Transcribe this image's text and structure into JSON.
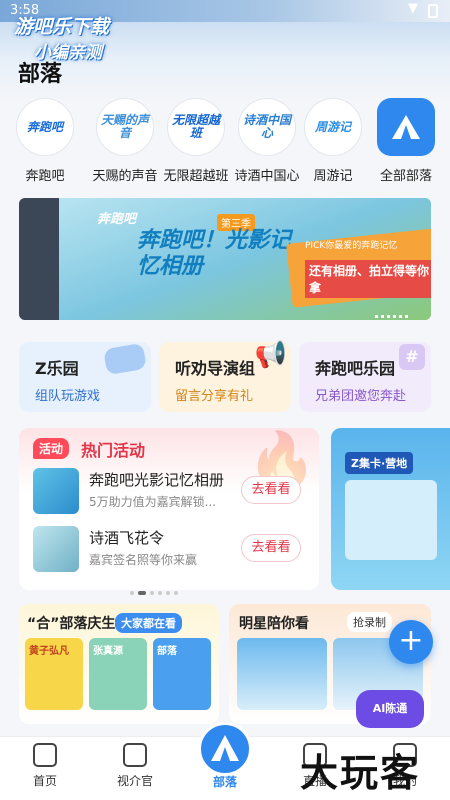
{
  "status": {
    "time": "3:58"
  },
  "watermark": {
    "line1": "游吧乐下载",
    "line2": "小编亲测"
  },
  "page": {
    "title": "部落"
  },
  "tribes": [
    {
      "label": "奔跑吧",
      "logo_text": "奔跑吧"
    },
    {
      "label": "天赐的声音",
      "logo_text": "天赐的声音"
    },
    {
      "label": "无限超越班",
      "logo_text": "无限超越班"
    },
    {
      "label": "诗酒中国心",
      "logo_text": "诗酒中国心"
    },
    {
      "label": "周游记",
      "logo_text": "周游记"
    },
    {
      "label": "全部部落",
      "logo_text": ""
    }
  ],
  "banner": {
    "brand": "奔跑吧",
    "title": "奔跑吧！光影记忆相册",
    "tag": "第三季",
    "pick": "PICK你最爱的奔跑记忆",
    "sub": "还有相册、拍立得等你拿"
  },
  "quick_cards": [
    {
      "title": "Z乐园",
      "sub": "组队玩游戏",
      "color": "#2f6fd1",
      "bg": "#e6f1fd"
    },
    {
      "title": "听劝导演组",
      "sub": "留言分享有礼",
      "color": "#d38418",
      "bg": "#fdf3df"
    },
    {
      "title": "奔跑吧乐园",
      "sub": "兄弟团邀您奔赴",
      "color": "#8a58c9",
      "bg": "#f1ebfb"
    }
  ],
  "hot": {
    "tag": "活动",
    "title": "热门活动",
    "items": [
      {
        "title": "奔跑吧光影记忆相册",
        "sub": "5万助力值为嘉宾解锁...",
        "button": "去看看"
      },
      {
        "title": "诗酒飞花令",
        "sub": "嘉宾签名照等你来赢",
        "button": "去看看"
      }
    ]
  },
  "side_card": {
    "title": "Z集卡·营地"
  },
  "bottom_left": {
    "title": "“合”部落庆生",
    "tag": "大家都在看",
    "items": [
      "黄子弘凡",
      "张真源",
      "部落"
    ]
  },
  "bottom_right": {
    "title": "明星陪你看",
    "tag": "抢录制"
  },
  "ai_badge": "AI陈通",
  "nav": [
    {
      "label": "首页"
    },
    {
      "label": "视介官"
    },
    {
      "label": "部落"
    },
    {
      "label": "直播"
    },
    {
      "label": "我的"
    }
  ],
  "corner_watermark": "大玩客",
  "colors": {
    "accent": "#2f88ee",
    "hot_red": "#e23548"
  }
}
